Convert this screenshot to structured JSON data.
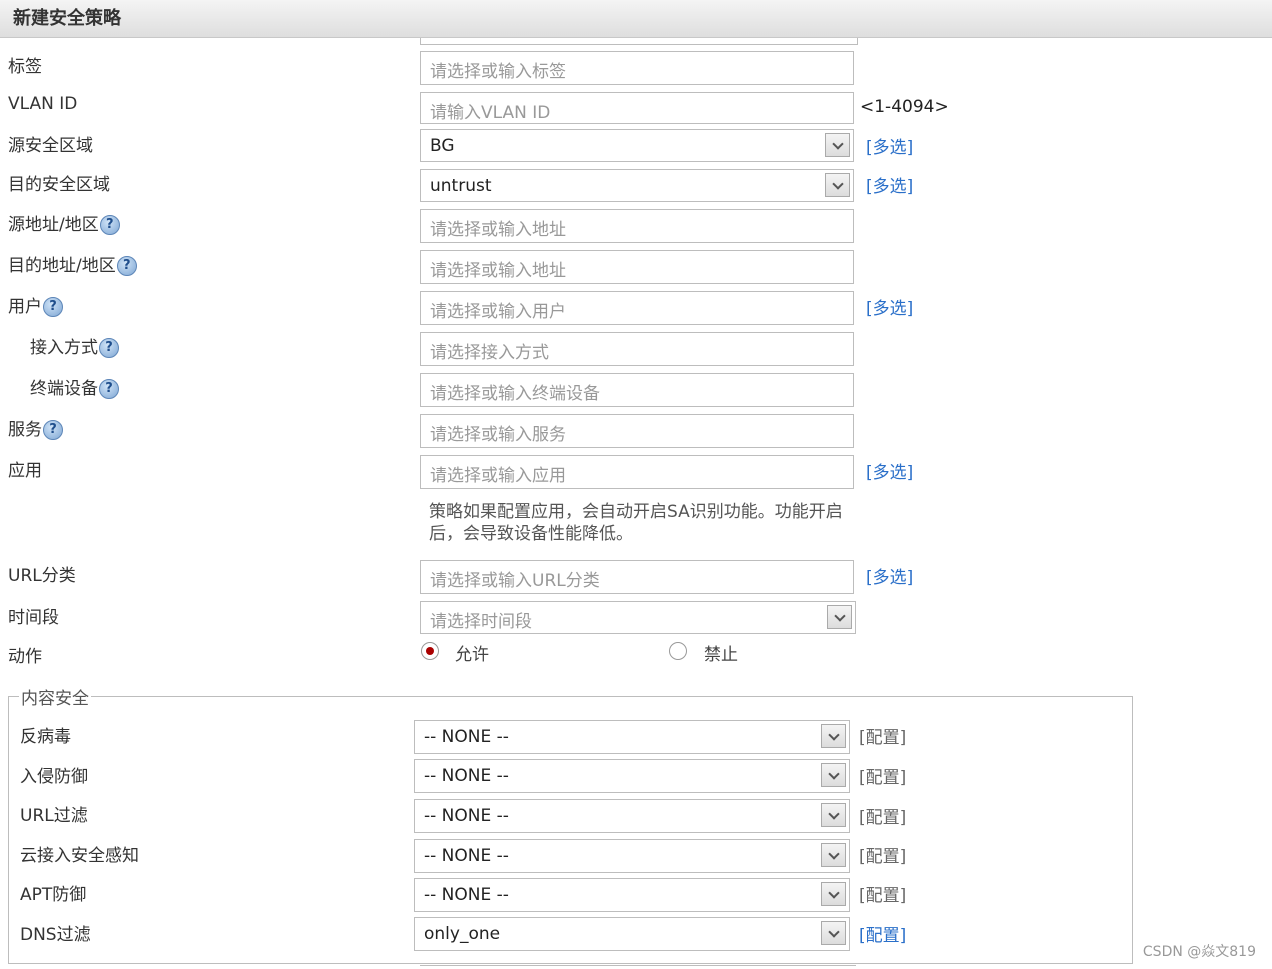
{
  "dialog": {
    "title": "新建安全策略"
  },
  "form": {
    "tag": {
      "label": "标签",
      "placeholder": "请选择或输入标签"
    },
    "vlan": {
      "label": "VLAN ID",
      "placeholder": "请输入VLAN ID",
      "range": "<1-4094>"
    },
    "src_zone": {
      "label": "源安全区域",
      "value": "BG",
      "multi": "[多选]"
    },
    "dst_zone": {
      "label": "目的安全区域",
      "value": "untrust",
      "multi": "[多选]"
    },
    "src_addr": {
      "label": "源地址/地区",
      "placeholder": "请选择或输入地址"
    },
    "dst_addr": {
      "label": "目的地址/地区",
      "placeholder": "请选择或输入地址"
    },
    "user": {
      "label": "用户",
      "placeholder": "请选择或输入用户",
      "multi": "[多选]"
    },
    "access": {
      "label": "接入方式",
      "placeholder": "请选择接入方式"
    },
    "terminal": {
      "label": "终端设备",
      "placeholder": "请选择或输入终端设备"
    },
    "service": {
      "label": "服务",
      "placeholder": "请选择或输入服务"
    },
    "app": {
      "label": "应用",
      "placeholder": "请选择或输入应用",
      "multi": "[多选]",
      "note_line1": "策略如果配置应用，会自动开启SA识别功能。功能开启",
      "note_line2": "后，会导致设备性能降低。"
    },
    "url": {
      "label": "URL分类",
      "placeholder": "请选择或输入URL分类",
      "multi": "[多选]"
    },
    "time": {
      "label": "时间段",
      "placeholder": "请选择时间段"
    },
    "action": {
      "label": "动作",
      "allow": "允许",
      "deny": "禁止",
      "selected": "允许"
    },
    "help_glyph": "?"
  },
  "content_security": {
    "legend": "内容安全",
    "rows": [
      {
        "label": "反病毒",
        "value": "-- NONE --",
        "config": "[配置]"
      },
      {
        "label": "入侵防御",
        "value": "-- NONE --",
        "config": "[配置]"
      },
      {
        "label": "URL过滤",
        "value": "-- NONE --",
        "config": "[配置]"
      },
      {
        "label": "云接入安全感知",
        "value": "-- NONE --",
        "config": "[配置]"
      },
      {
        "label": "APT防御",
        "value": "-- NONE --",
        "config": "[配置]"
      },
      {
        "label": "DNS过滤",
        "value": "only_one",
        "config": "[配置]"
      }
    ]
  },
  "watermark": "CSDN @焱文819"
}
